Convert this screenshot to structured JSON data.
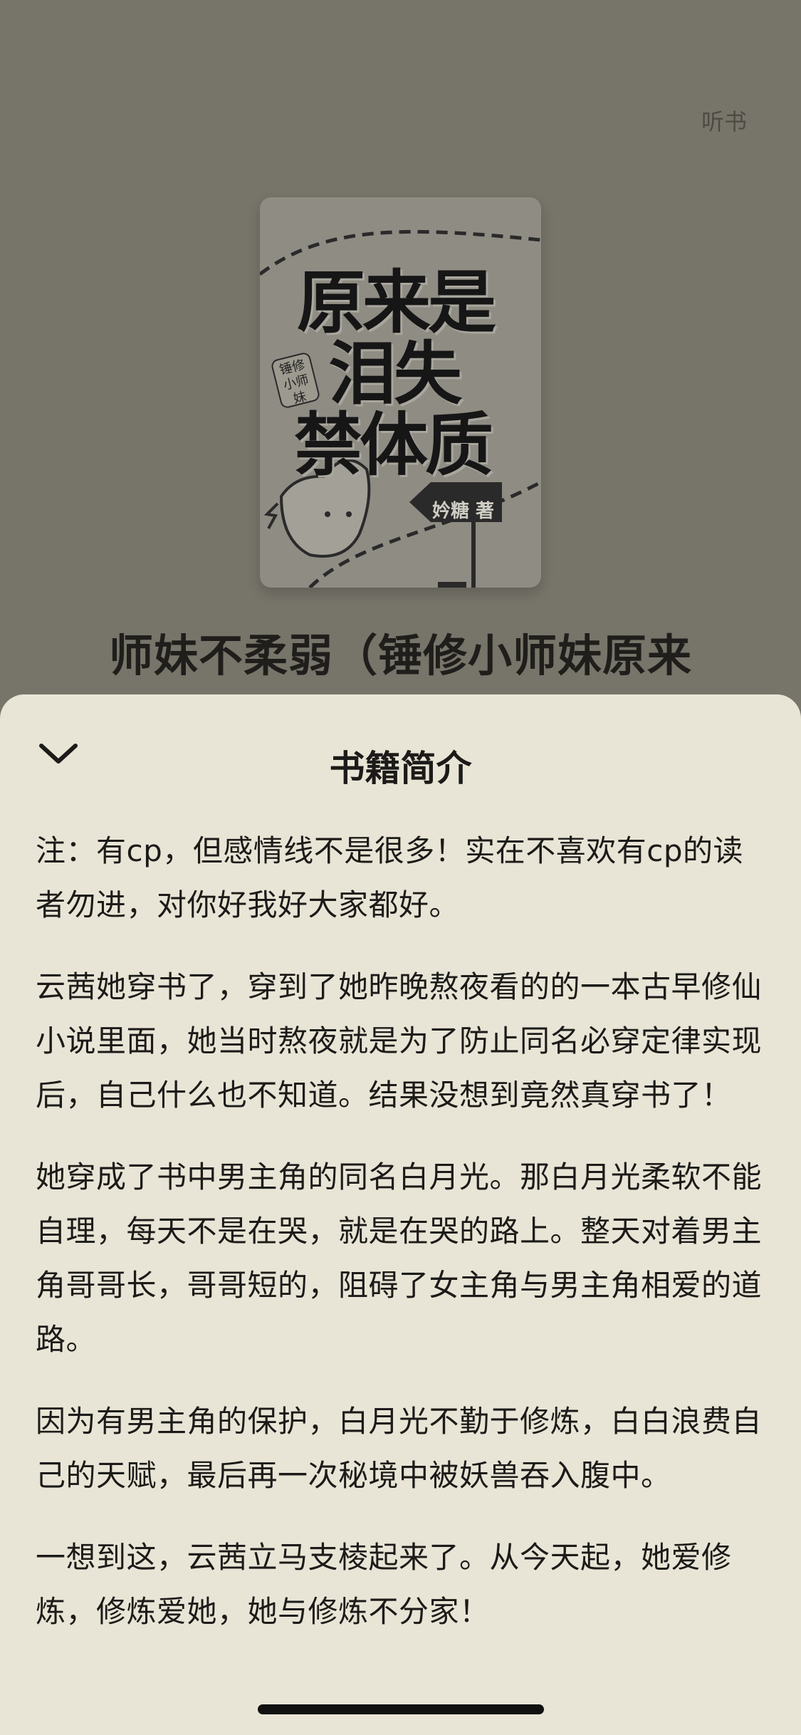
{
  "header": {
    "listen_label": "听书"
  },
  "cover": {
    "title_lines": [
      "原来是",
      "泪失",
      "禁体质"
    ],
    "tag_text": "锤修小师妹",
    "author_label": "妗糖 著"
  },
  "book": {
    "title": "师妹不柔弱（锤修小师妹原来"
  },
  "sheet": {
    "title": "书籍简介",
    "close_icon": "chevron-down-icon",
    "paragraphs": [
      "注：有cp，但感情线不是很多！实在不喜欢有cp的读者勿进，对你好我好大家都好。",
      "云茜她穿书了，穿到了她昨晚熬夜看的的一本古早修仙小说里面，她当时熬夜就是为了防止同名必穿定律实现后，自己什么也不知道。结果没想到竟然真穿书了！",
      "她穿成了书中男主角的同名白月光。那白月光柔软不能自理，每天不是在哭，就是在哭的路上。整天对着男主角哥哥长，哥哥短的，阻碍了女主角与男主角相爱的道路。",
      "因为有男主角的保护，白月光不勤于修炼，白白浪费自己的天赋，最后再一次秘境中被妖兽吞入腹中。",
      "一想到这，云茜立马支棱起来了。从今天起，她爱修炼，修炼爱她，她与修炼不分家！"
    ]
  },
  "colors": {
    "dim_background": "#77746a",
    "sheet_background": "#e9e5d6",
    "text": "#1c1b19"
  }
}
